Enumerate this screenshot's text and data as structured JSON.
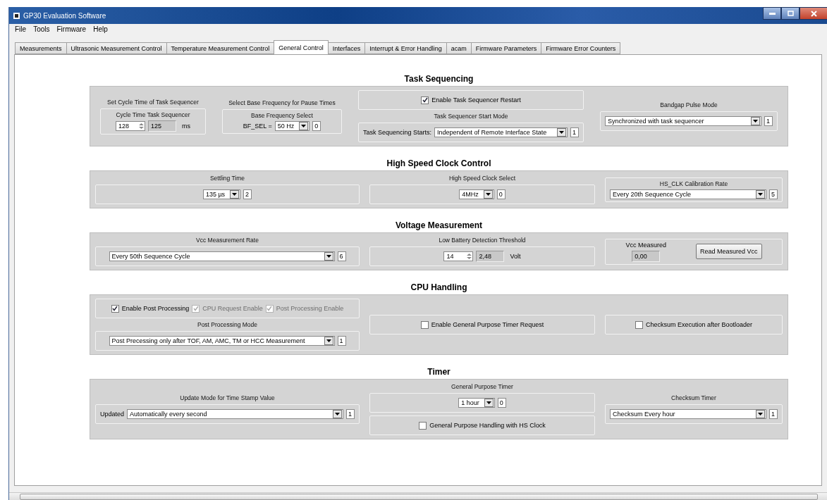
{
  "window": {
    "title": "GP30 Evaluation Software"
  },
  "menu": [
    "File",
    "Tools",
    "Firmware",
    "Help"
  ],
  "tabs": [
    {
      "label": "Measurements",
      "selected": false
    },
    {
      "label": "Ultrasonic Measurement Control",
      "selected": false
    },
    {
      "label": "Temperature Measurement Control",
      "selected": false
    },
    {
      "label": "General Control",
      "selected": true
    },
    {
      "label": "Interfaces",
      "selected": false
    },
    {
      "label": "Interrupt & Error Handling",
      "selected": false
    },
    {
      "label": "acam",
      "selected": false
    },
    {
      "label": "Firmware Parameters",
      "selected": false
    },
    {
      "label": "Firmware Error Counters",
      "selected": false
    }
  ],
  "sections": [
    {
      "title": "Task Sequencing",
      "columns": [
        {
          "items": [
            {
              "kind": "label",
              "text": "Set Cycle Time of Task Sequencer"
            },
            {
              "kind": "frame",
              "caption": "Cycle Time Task Sequencer",
              "controls": [
                {
                  "kind": "numeric",
                  "value": "128"
                },
                {
                  "kind": "readout",
                  "value": "125"
                },
                {
                  "kind": "unit",
                  "text": "ms"
                }
              ]
            }
          ]
        },
        {
          "items": [
            {
              "kind": "label",
              "text": "Select Base Frequency for Pause Times"
            },
            {
              "kind": "frame",
              "caption": "Base Frequency Select",
              "controls": [
                {
                  "kind": "text",
                  "text": "BF_SEL ="
                },
                {
                  "kind": "dropdown",
                  "value": "50 Hz",
                  "index": "0"
                }
              ]
            }
          ]
        },
        {
          "items": [
            {
              "kind": "frame",
              "controls": [
                {
                  "kind": "checkbox",
                  "label": "Enable Task Sequencer Restart",
                  "checked": true,
                  "disabled": false
                }
              ]
            },
            {
              "kind": "label",
              "text": "Task Sequencer Start Mode"
            },
            {
              "kind": "frame",
              "controls": [
                {
                  "kind": "text",
                  "text": "Task Sequencing Starts:"
                },
                {
                  "kind": "dropdown",
                  "value": "Independent of Remote Interface State",
                  "index": "1"
                }
              ]
            }
          ]
        },
        {
          "items": [
            {
              "kind": "label",
              "text": "Bandgap Pulse Mode"
            },
            {
              "kind": "frame",
              "controls": [
                {
                  "kind": "dropdown",
                  "value": "Synchronized with task sequencer",
                  "index": "1"
                }
              ]
            }
          ]
        }
      ]
    },
    {
      "title": "High Speed Clock Control",
      "columns": [
        {
          "items": [
            {
              "kind": "label",
              "text": "Settling Time"
            },
            {
              "kind": "frame",
              "controls": [
                {
                  "kind": "dropdown",
                  "value": "135 µs",
                  "index": "2"
                }
              ]
            }
          ]
        },
        {
          "items": [
            {
              "kind": "label",
              "text": "High Speed Clock Select"
            },
            {
              "kind": "frame",
              "controls": [
                {
                  "kind": "dropdown",
                  "value": "4MHz",
                  "index": "0"
                }
              ]
            }
          ]
        },
        {
          "items": [
            {
              "kind": "frame",
              "caption": "HS_CLK Calibration Rate",
              "controls": [
                {
                  "kind": "dropdown",
                  "value": "Every 20th Sequence Cycle",
                  "index": "5"
                }
              ]
            }
          ]
        }
      ]
    },
    {
      "title": "Voltage Measurement",
      "columns": [
        {
          "items": [
            {
              "kind": "label",
              "text": "Vcc Measurement Rate"
            },
            {
              "kind": "frame",
              "controls": [
                {
                  "kind": "dropdown",
                  "value": "Every 50th Sequence Cycle",
                  "index": "6"
                }
              ]
            }
          ]
        },
        {
          "items": [
            {
              "kind": "label",
              "text": "Low Battery Detection Threshold"
            },
            {
              "kind": "frame",
              "controls": [
                {
                  "kind": "numeric",
                  "value": "14"
                },
                {
                  "kind": "readout",
                  "value": "2,48"
                },
                {
                  "kind": "unit",
                  "text": "Volt"
                }
              ]
            }
          ]
        },
        {
          "items": [
            {
              "kind": "frame",
              "controls": [
                {
                  "kind": "stack",
                  "controls": [
                    {
                      "kind": "text",
                      "text": "Vcc Measured"
                    },
                    {
                      "kind": "readout",
                      "value": "0,00"
                    }
                  ]
                },
                {
                  "kind": "button",
                  "label": "Read Measured Vcc"
                }
              ]
            }
          ]
        }
      ]
    },
    {
      "title": "CPU Handling",
      "columns": [
        {
          "items": [
            {
              "kind": "frame",
              "controls": [
                {
                  "kind": "checkbox",
                  "label": "Enable Post Processing",
                  "checked": true,
                  "disabled": false
                },
                {
                  "kind": "checkbox",
                  "label": "CPU Request Enable",
                  "checked": true,
                  "disabled": true
                },
                {
                  "kind": "checkbox",
                  "label": "Post Processing Enable",
                  "checked": true,
                  "disabled": true
                }
              ]
            },
            {
              "kind": "label",
              "text": "Post Processing Mode"
            },
            {
              "kind": "frame",
              "controls": [
                {
                  "kind": "dropdown",
                  "value": "Post Precessing only after TOF, AM, AMC, TM or HCC Measurement",
                  "index": "1"
                }
              ]
            }
          ]
        },
        {
          "items": [
            {
              "kind": "frame",
              "controls": [
                {
                  "kind": "checkbox",
                  "label": "Enable General Purpose Timer Request",
                  "checked": false,
                  "disabled": false
                }
              ]
            }
          ]
        },
        {
          "items": [
            {
              "kind": "frame",
              "controls": [
                {
                  "kind": "checkbox",
                  "label": "Checksum Execution after Bootloader",
                  "checked": false,
                  "disabled": false
                }
              ]
            }
          ]
        }
      ]
    },
    {
      "title": "Timer",
      "columns": [
        {
          "items": [
            {
              "kind": "label",
              "text": "Update Mode for Time Stamp Value"
            },
            {
              "kind": "frame",
              "controls": [
                {
                  "kind": "text",
                  "text": "Updated"
                },
                {
                  "kind": "dropdown",
                  "value": "Automatically every second",
                  "index": "1"
                }
              ]
            }
          ]
        },
        {
          "items": [
            {
              "kind": "label",
              "text": "General Purpose Timer"
            },
            {
              "kind": "frame",
              "controls": [
                {
                  "kind": "dropdown",
                  "value": "1 hour",
                  "index": "0"
                }
              ]
            },
            {
              "kind": "frame",
              "controls": [
                {
                  "kind": "checkbox",
                  "label": "General Purpose Handling with HS Clock",
                  "checked": false,
                  "disabled": false
                }
              ]
            }
          ]
        },
        {
          "items": [
            {
              "kind": "label",
              "text": "Checksum Timer"
            },
            {
              "kind": "frame",
              "controls": [
                {
                  "kind": "dropdown",
                  "value": "Checksum Every hour",
                  "index": "1"
                }
              ]
            }
          ]
        }
      ]
    }
  ]
}
